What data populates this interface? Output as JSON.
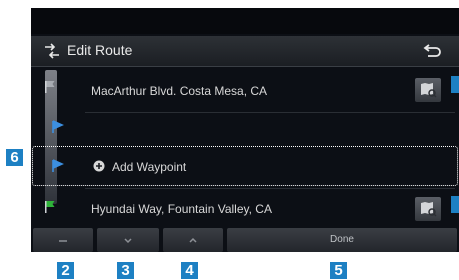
{
  "header": {
    "title": "Edit Route"
  },
  "route": {
    "start": "MacArthur Blvd. Costa Mesa, CA",
    "waypoint_label": "Add Waypoint",
    "destination": "Hyundai Way, Fountain Valley, CA"
  },
  "bottom_bar": {
    "done_label": "Done"
  },
  "callouts": {
    "c2": "2",
    "c3": "3",
    "c4": "4",
    "c5": "5",
    "c6": "6"
  },
  "colors": {
    "callout": "#1d80c3",
    "screen_bg": "#0c0f15",
    "accent_blue": "#3c8fe0"
  }
}
